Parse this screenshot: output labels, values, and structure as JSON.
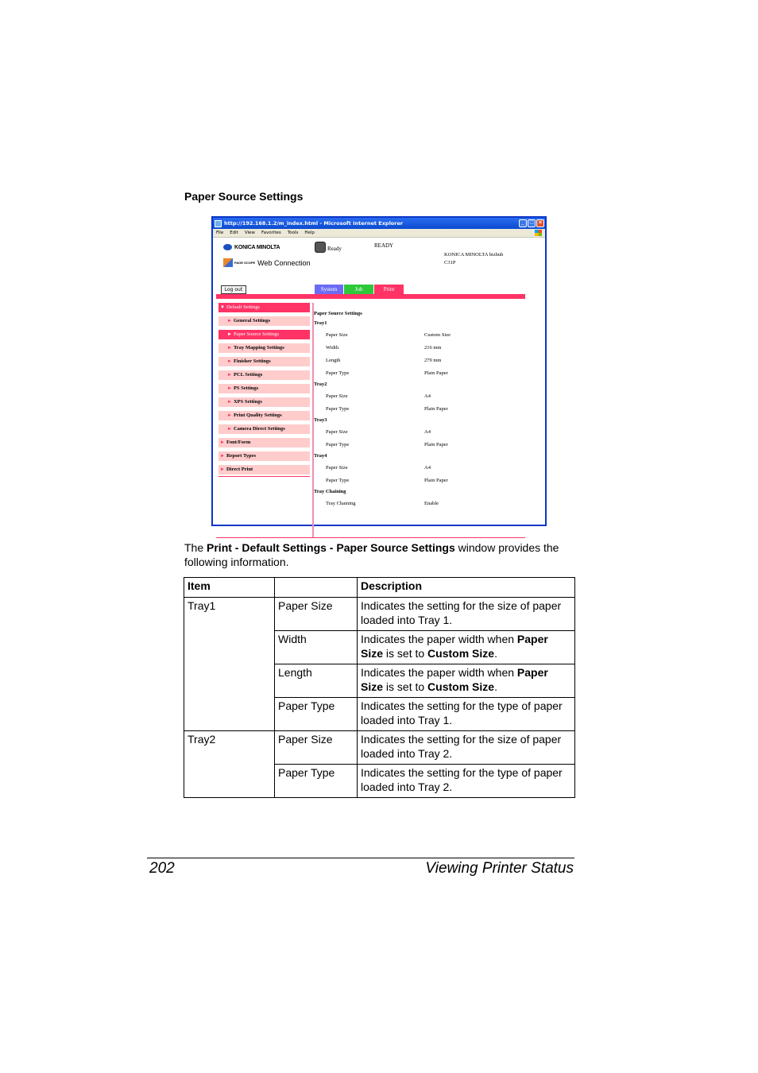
{
  "section_title": "Paper Source Settings",
  "browser": {
    "title": "http://192.168.1.2/m_index.html - Microsoft Internet Explorer",
    "menu": [
      "File",
      "Edit",
      "View",
      "Favorites",
      "Tools",
      "Help"
    ],
    "window_buttons": {
      "minimize": "_",
      "maximize": "□",
      "close": "×"
    }
  },
  "webpage": {
    "brand": "KONICA MINOLTA",
    "product_logo": "Web Connection",
    "product_logo_small": "PAGE SCOPE",
    "status_text": "Ready",
    "status_value": "READY",
    "model_line1": "KONICA MINOLTA bizhub",
    "model_line2": "C31P",
    "logout_label": "Log out",
    "tabs": [
      {
        "label": "System",
        "color": "#6b6bf5"
      },
      {
        "label": "Job",
        "color": "#2ec83a"
      },
      {
        "label": "Print",
        "color": "#ff3366"
      }
    ],
    "sidebar": [
      {
        "label": "Default Settings",
        "arrow": "▼",
        "level": 0,
        "active": true
      },
      {
        "label": "General Settings",
        "arrow": "►",
        "level": 1,
        "active": false
      },
      {
        "label": "Paper Source Settings",
        "arrow": "►",
        "level": 1,
        "active": true
      },
      {
        "label": "Tray Mapping Settings",
        "arrow": "►",
        "level": 1,
        "active": false
      },
      {
        "label": "Finisher Settings",
        "arrow": "►",
        "level": 1,
        "active": false
      },
      {
        "label": "PCL Settings",
        "arrow": "►",
        "level": 1,
        "active": false
      },
      {
        "label": "PS Settings",
        "arrow": "►",
        "level": 1,
        "active": false
      },
      {
        "label": "XPS Settings",
        "arrow": "►",
        "level": 1,
        "active": false
      },
      {
        "label": "Print Quality Settings",
        "arrow": "►",
        "level": 1,
        "active": false
      },
      {
        "label": "Camera Direct Settings",
        "arrow": "►",
        "level": 1,
        "active": false
      },
      {
        "label": "Font/Form",
        "arrow": "►",
        "level": 0,
        "active": false
      },
      {
        "label": "Report Types",
        "arrow": "►",
        "level": 0,
        "active": false
      },
      {
        "label": "Direct Print",
        "arrow": "►",
        "level": 0,
        "active": false
      }
    ],
    "content": {
      "heading": "Paper Source Settings",
      "sections": [
        {
          "name": "Tray1",
          "rows": [
            {
              "label": "Paper Size",
              "value": "Custom Size"
            },
            {
              "label": "Width",
              "value": "216 mm"
            },
            {
              "label": "Length",
              "value": "279 mm"
            },
            {
              "label": "Paper Type",
              "value": "Plain Paper"
            }
          ]
        },
        {
          "name": "Tray2",
          "rows": [
            {
              "label": "Paper Size",
              "value": "A4"
            },
            {
              "label": "Paper Type",
              "value": "Plain Paper"
            }
          ]
        },
        {
          "name": "Tray3",
          "rows": [
            {
              "label": "Paper Size",
              "value": "A4"
            },
            {
              "label": "Paper Type",
              "value": "Plain Paper"
            }
          ]
        },
        {
          "name": "Tray4",
          "rows": [
            {
              "label": "Paper Size",
              "value": "A4"
            },
            {
              "label": "Paper Type",
              "value": "Plain Paper"
            }
          ]
        },
        {
          "name": "Tray Chaining",
          "rows": [
            {
              "label": "Tray Chaining",
              "value": "Enable"
            }
          ]
        }
      ]
    }
  },
  "paragraph": {
    "prefix": "The ",
    "bold": "Print - Default Settings - Paper Source Settings",
    "suffix": " window provides the following information."
  },
  "table": {
    "headers": [
      "Item",
      "",
      "Description"
    ],
    "groups": [
      {
        "item": "Tray1",
        "rows": [
          {
            "sub": "Paper Size",
            "desc": [
              {
                "t": "Indicates the setting for the size of paper loaded into Tray 1."
              }
            ]
          },
          {
            "sub": "Width",
            "desc": [
              {
                "t": "Indicates the paper width when "
              },
              {
                "t": "Paper Size",
                "b": true
              },
              {
                "t": " is set to "
              },
              {
                "t": "Custom Size",
                "b": true
              },
              {
                "t": "."
              }
            ]
          },
          {
            "sub": "Length",
            "desc": [
              {
                "t": "Indicates the paper width when "
              },
              {
                "t": "Paper Size",
                "b": true
              },
              {
                "t": " is set to "
              },
              {
                "t": "Custom Size",
                "b": true
              },
              {
                "t": "."
              }
            ]
          },
          {
            "sub": "Paper Type",
            "desc": [
              {
                "t": "Indicates the setting for the type of paper loaded into Tray 1."
              }
            ]
          }
        ]
      },
      {
        "item": "Tray2",
        "rows": [
          {
            "sub": "Paper Size",
            "desc": [
              {
                "t": "Indicates the setting for the size of paper loaded into Tray 2."
              }
            ]
          },
          {
            "sub": "Paper Type",
            "desc": [
              {
                "t": "Indicates the setting for the type of paper loaded into Tray 2."
              }
            ]
          }
        ]
      }
    ]
  },
  "footer": {
    "page_number": "202",
    "chapter": "Viewing Printer Status"
  }
}
